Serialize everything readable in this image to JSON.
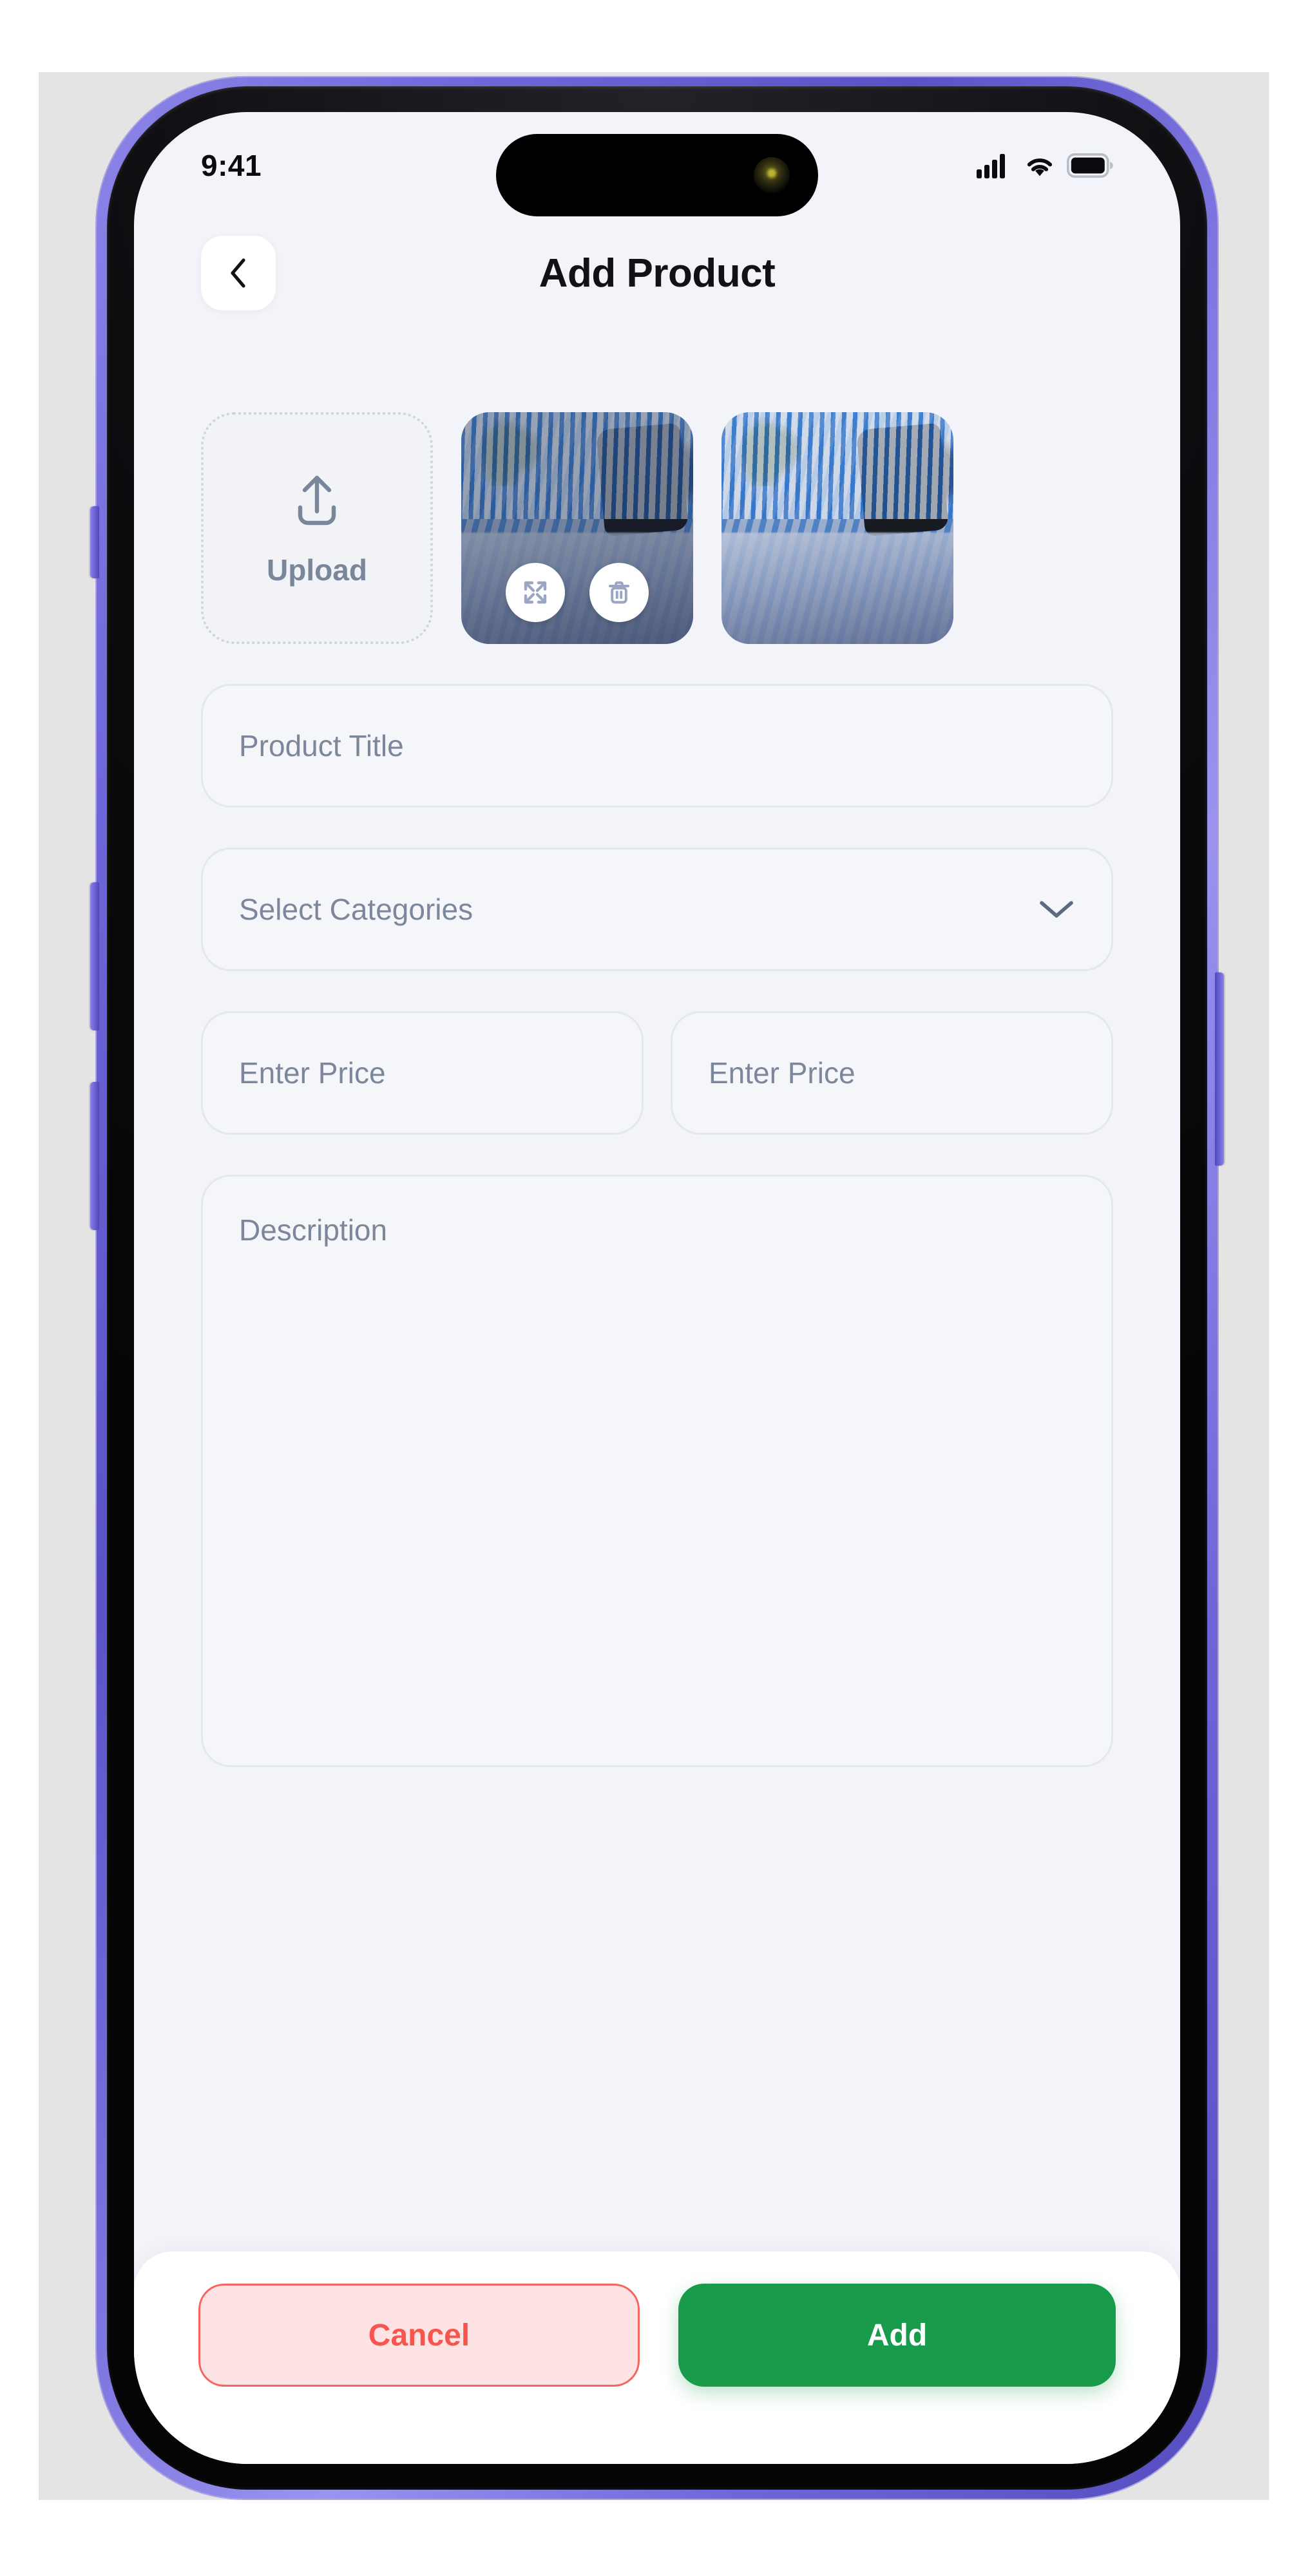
{
  "status_bar": {
    "time": "9:41",
    "icons": [
      "cellular-signal-icon",
      "wifi-icon",
      "battery-icon"
    ]
  },
  "header": {
    "back_icon": "chevron-left-icon",
    "title": "Add Product"
  },
  "media": {
    "upload": {
      "icon": "upload-icon",
      "label": "Upload"
    },
    "thumbnails": [
      {
        "alt": "Blue striped bedding product photo",
        "selected": true,
        "actions": [
          {
            "icon": "expand-icon",
            "name": "expand-image-button"
          },
          {
            "icon": "trash-icon",
            "name": "delete-image-button"
          }
        ]
      },
      {
        "alt": "Blue striped bedding product photo",
        "selected": false,
        "actions": []
      }
    ]
  },
  "form": {
    "product_title": {
      "placeholder": "Product Title",
      "value": ""
    },
    "categories": {
      "placeholder": "Select Categories",
      "value": "",
      "chevron_icon": "chevron-down-icon"
    },
    "price_primary": {
      "placeholder": "Enter Price",
      "value": ""
    },
    "price_secondary": {
      "placeholder": "Enter Price",
      "value": ""
    },
    "description": {
      "placeholder": "Description",
      "value": ""
    }
  },
  "actions": {
    "cancel_label": "Cancel",
    "add_label": "Add"
  },
  "colors": {
    "page_background": "#f3f4f9",
    "field_background": "#f5f6fa",
    "field_border": "#e5e7ee",
    "placeholder_text": "#7c879b",
    "title_text": "#111218",
    "cancel_background": "#fde3e3",
    "cancel_border": "#f8645f",
    "cancel_text": "#f8554f",
    "add_background": "#189b4a",
    "add_text": "#ffffff",
    "device_rim": "#6f66d8"
  }
}
